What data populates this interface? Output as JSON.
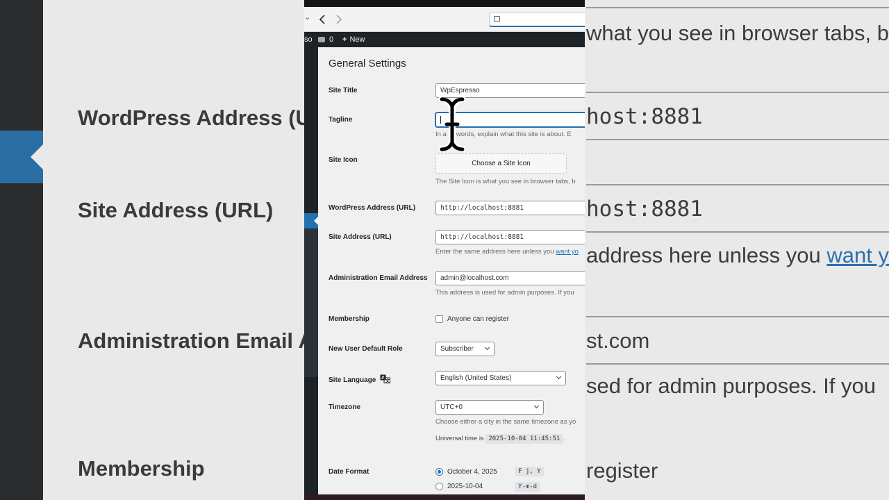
{
  "background": {
    "labels": [
      "WordPress Address (U",
      "Site Address (URL)",
      "Administration Email A",
      "Membership"
    ],
    "right_texts": [
      "what you see in browser tabs, b",
      "host:8881",
      "host:8881",
      "address here unless you ",
      "want yo",
      "st.com",
      "sed for admin purposes. If you",
      "register"
    ]
  },
  "browser": {
    "address_text": ""
  },
  "adminbar": {
    "site_fragment": "so",
    "comments_count": "0",
    "new_label": "New"
  },
  "page": {
    "title": "General Settings"
  },
  "fields": {
    "site_title_label": "Site Title",
    "site_title_value": "WpEspresso",
    "tagline_label": "Tagline",
    "tagline_value": "",
    "tagline_desc_a": "In a",
    "tagline_desc_b": "words, explain what this site is about. E",
    "site_icon_label": "Site Icon",
    "site_icon_button": "Choose a Site Icon",
    "site_icon_desc": "The Site Icon is what you see in browser tabs, b",
    "wp_address_label": "WordPress Address (URL)",
    "wp_address_value": "http://localhost:8881",
    "site_address_label": "Site Address (URL)",
    "site_address_value": "http://localhost:8881",
    "site_address_desc": "Enter the same address here unless you ",
    "site_address_link": "want yo",
    "admin_email_label": "Administration Email Address",
    "admin_email_value": "admin@localhost.com",
    "admin_email_desc": "This address is used for admin purposes. If you",
    "membership_label": "Membership",
    "membership_option": "Anyone can register",
    "default_role_label": "New User Default Role",
    "default_role_value": "Subscriber",
    "language_label": "Site Language",
    "language_value": "English (United States)",
    "timezone_label": "Timezone",
    "timezone_value": "UTC+0",
    "timezone_desc": "Choose either a city in the same timezone as yo",
    "universal_time_label": "Universal time is",
    "universal_time_value": "2025-10-04 11:45:51",
    "universal_time_suffix": ".",
    "date_format_label": "Date Format",
    "date_options": [
      {
        "label": "October 4, 2025",
        "code": "F j, Y",
        "selected": true
      },
      {
        "label": "2025-10-04",
        "code": "Y-m-d",
        "selected": false
      }
    ]
  },
  "colors": {
    "accent": "#2271b1",
    "adminbar": "#1d2327"
  }
}
